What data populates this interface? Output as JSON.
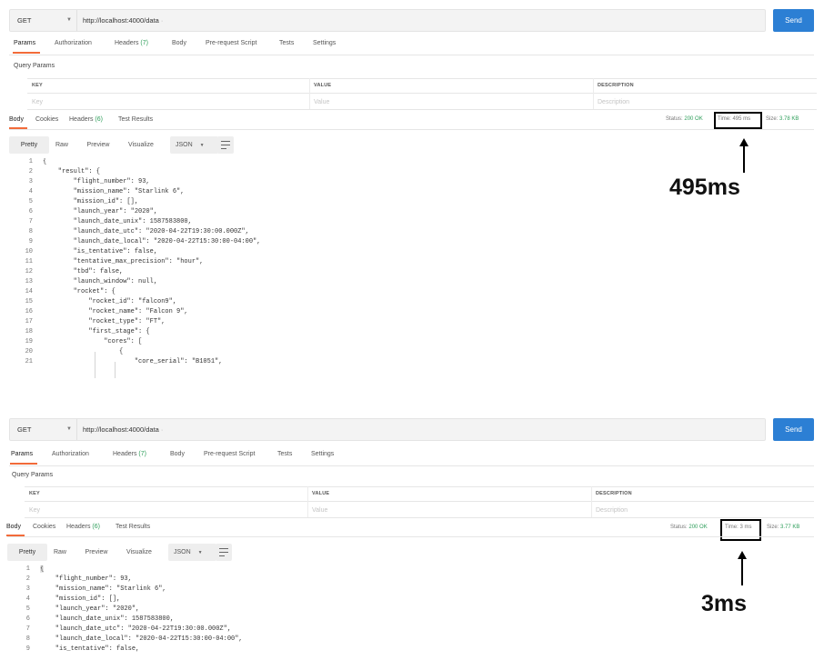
{
  "top": {
    "method": "GET",
    "url": "http://localhost:4000/data",
    "send_label": "Send",
    "request_tabs": [
      {
        "label": "Params"
      },
      {
        "label": "Authorization"
      },
      {
        "label": "Headers",
        "count": "(7)"
      },
      {
        "label": "Body"
      },
      {
        "label": "Pre-request Script"
      },
      {
        "label": "Tests"
      },
      {
        "label": "Settings"
      }
    ],
    "query_params_title": "Query Params",
    "columns": {
      "key": "KEY",
      "value": "VALUE",
      "description": "DESCRIPTION"
    },
    "placeholders": {
      "key": "Key",
      "value": "Value",
      "description": "Description"
    },
    "response_tabs": [
      {
        "label": "Body"
      },
      {
        "label": "Cookies"
      },
      {
        "label": "Headers",
        "count": "(6)"
      },
      {
        "label": "Test Results"
      }
    ],
    "status_label": "Status:",
    "status_value": "200 OK",
    "time_text": "Time: 495 ms",
    "size_label": "Size:",
    "size_value": "3.78 KB",
    "view_buttons": [
      "Pretty",
      "Raw",
      "Preview",
      "Visualize"
    ],
    "format": "JSON",
    "annotation": "495ms",
    "code_lines": [
      {
        "n": "1",
        "t": "{"
      },
      {
        "n": "2",
        "t": "    \"result\": {"
      },
      {
        "n": "3",
        "t": "        \"flight_number\": 93,"
      },
      {
        "n": "4",
        "t": "        \"mission_name\": \"Starlink 6\","
      },
      {
        "n": "5",
        "t": "        \"mission_id\": [],"
      },
      {
        "n": "6",
        "t": "        \"launch_year\": \"2020\","
      },
      {
        "n": "7",
        "t": "        \"launch_date_unix\": 1587583800,"
      },
      {
        "n": "8",
        "t": "        \"launch_date_utc\": \"2020-04-22T19:30:00.000Z\","
      },
      {
        "n": "9",
        "t": "        \"launch_date_local\": \"2020-04-22T15:30:00-04:00\","
      },
      {
        "n": "10",
        "t": "        \"is_tentative\": false,"
      },
      {
        "n": "11",
        "t": "        \"tentative_max_precision\": \"hour\","
      },
      {
        "n": "12",
        "t": "        \"tbd\": false,"
      },
      {
        "n": "13",
        "t": "        \"launch_window\": null,"
      },
      {
        "n": "14",
        "t": "        \"rocket\": {"
      },
      {
        "n": "15",
        "t": "            \"rocket_id\": \"falcon9\","
      },
      {
        "n": "16",
        "t": "            \"rocket_name\": \"Falcon 9\","
      },
      {
        "n": "17",
        "t": "            \"rocket_type\": \"FT\","
      },
      {
        "n": "18",
        "t": "            \"first_stage\": {"
      },
      {
        "n": "19",
        "t": "                \"cores\": ["
      },
      {
        "n": "20",
        "t": "                    {"
      },
      {
        "n": "21",
        "t": "                        \"core_serial\": \"B1051\","
      }
    ]
  },
  "bottom": {
    "method": "GET",
    "url": "http://localhost:4000/data",
    "send_label": "Send",
    "request_tabs": [
      {
        "label": "Params"
      },
      {
        "label": "Authorization"
      },
      {
        "label": "Headers",
        "count": "(7)"
      },
      {
        "label": "Body"
      },
      {
        "label": "Pre-request Script"
      },
      {
        "label": "Tests"
      },
      {
        "label": "Settings"
      }
    ],
    "query_params_title": "Query Params",
    "columns": {
      "key": "KEY",
      "value": "VALUE",
      "description": "DESCRIPTION"
    },
    "placeholders": {
      "key": "Key",
      "value": "Value",
      "description": "Description"
    },
    "response_tabs": [
      {
        "label": "Body"
      },
      {
        "label": "Cookies"
      },
      {
        "label": "Headers",
        "count": "(6)"
      },
      {
        "label": "Test Results"
      }
    ],
    "status_label": "Status:",
    "status_value": "200 OK",
    "time_text": "Time: 3 ms",
    "size_label": "Size:",
    "size_value": "3.77 KB",
    "view_buttons": [
      "Pretty",
      "Raw",
      "Preview",
      "Visualize"
    ],
    "format": "JSON",
    "annotation": "3ms",
    "code_lines": [
      {
        "n": "1",
        "t": "{"
      },
      {
        "n": "2",
        "t": "    \"flight_number\": 93,"
      },
      {
        "n": "3",
        "t": "    \"mission_name\": \"Starlink 6\","
      },
      {
        "n": "4",
        "t": "    \"mission_id\": [],"
      },
      {
        "n": "5",
        "t": "    \"launch_year\": \"2020\","
      },
      {
        "n": "6",
        "t": "    \"launch_date_unix\": 1587583800,"
      },
      {
        "n": "7",
        "t": "    \"launch_date_utc\": \"2020-04-22T19:30:00.000Z\","
      },
      {
        "n": "8",
        "t": "    \"launch_date_local\": \"2020-04-22T15:30:00-04:00\","
      },
      {
        "n": "9",
        "t": "    \"is_tentative\": false,"
      }
    ]
  }
}
